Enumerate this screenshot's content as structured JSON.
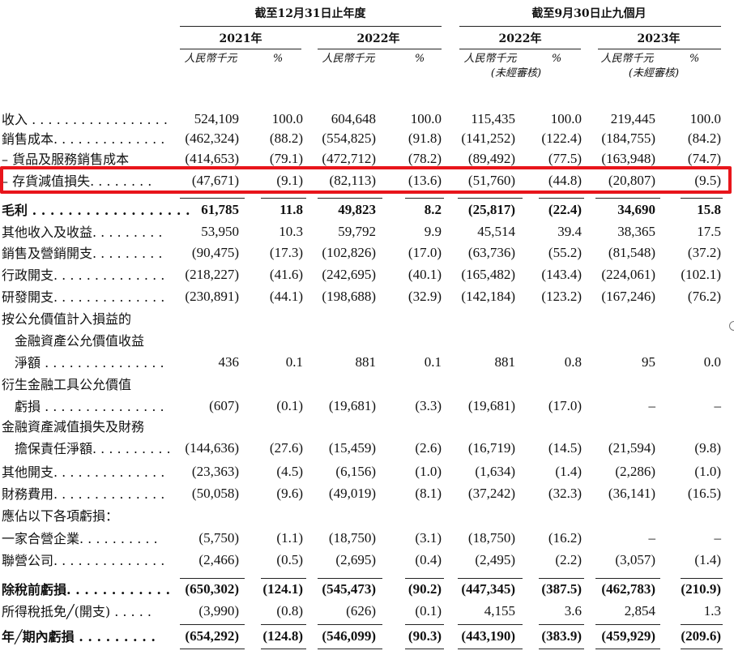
{
  "header": {
    "group_annual": "截至12月31日止年度",
    "group_nine": "截至9月30日止九個月",
    "years": [
      "2021年",
      "2022年",
      "2022年",
      "2023年"
    ],
    "unit_rmb": "人民幣千元",
    "unit_pct": "%",
    "unaudited": "(未經審核)"
  },
  "rows": [
    {
      "lines": [
        "收入 . . . . . . . . . . . . . . . . ."
      ],
      "values": [
        "524,109",
        "100.0",
        "604,648",
        "100.0",
        "115,435",
        "100.0",
        "219,445",
        "100.0"
      ]
    },
    {
      "lines": [
        "銷售成本. . . . . . . . . . . . . ."
      ],
      "values": [
        "(462,324)",
        "(88.2)",
        "(554,825)",
        "(91.8)",
        "(141,252)",
        "(122.4)",
        "(184,755)",
        "(84.2)"
      ]
    },
    {
      "lines": [
        "– 貨品及服務銷售成本"
      ],
      "values": [
        "(414,653)",
        "(79.1)",
        "(472,712)",
        "(78.2)",
        "(89,492)",
        "(77.5)",
        "(163,948)",
        "(74.7)"
      ]
    },
    {
      "lines": [
        "– 存貨減值損失. . . . . . . ."
      ],
      "values": [
        "(47,671)",
        "(9.1)",
        "(82,113)",
        "(13.6)",
        "(51,760)",
        "(44.8)",
        "(20,807)",
        "(9.5)"
      ]
    },
    {
      "lines": [
        "毛利 . . . . . . . . . . . . . . . . . ."
      ],
      "values": [
        "61,785",
        "11.8",
        "49,823",
        "8.2",
        "(25,817)",
        "(22.4)",
        "34,690",
        "15.8"
      ]
    },
    {
      "lines": [
        "其他收入及收益. . . . . . . . ."
      ],
      "values": [
        "53,950",
        "10.3",
        "59,792",
        "9.9",
        "45,514",
        "39.4",
        "38,365",
        "17.5"
      ]
    },
    {
      "lines": [
        "銷售及營銷開支. . . . . . . . ."
      ],
      "values": [
        "(90,475)",
        "(17.3)",
        "(102,826)",
        "(17.0)",
        "(63,736)",
        "(55.2)",
        "(81,548)",
        "(37.2)"
      ]
    },
    {
      "lines": [
        "行政開支. . . . . . . . . . . . . ."
      ],
      "values": [
        "(218,227)",
        "(41.6)",
        "(242,695)",
        "(40.1)",
        "(165,482)",
        "(143.4)",
        "(224,061)",
        "(102.1)"
      ]
    },
    {
      "lines": [
        "研發開支. . . . . . . . . . . . . ."
      ],
      "values": [
        "(230,891)",
        "(44.1)",
        "(198,688)",
        "(32.9)",
        "(142,184)",
        "(123.2)",
        "(167,246)",
        "(76.2)"
      ]
    },
    {
      "lines": [
        "按公允價值計入損益的",
        "金融資產公允價值收益",
        "淨額 . . . . . . . . . . . . . . ."
      ],
      "values": [
        "436",
        "0.1",
        "881",
        "0.1",
        "881",
        "0.8",
        "95",
        "0.0"
      ]
    },
    {
      "lines": [
        "衍生金融工具公允價值",
        "虧損 . . . . . . . . . . . . . . ."
      ],
      "values": [
        "(607)",
        "(0.1)",
        "(19,681)",
        "(3.3)",
        "(19,681)",
        "(17.0)",
        "–",
        "–"
      ]
    },
    {
      "lines": [
        "金融資產減值損失及財務",
        "擔保責任淨額. . . . . . . . . ."
      ],
      "values": [
        "(144,636)",
        "(27.6)",
        "(15,459)",
        "(2.6)",
        "(16,719)",
        "(14.5)",
        "(21,594)",
        "(9.8)"
      ]
    },
    {
      "lines": [
        "其他開支. . . . . . . . . . . . . ."
      ],
      "values": [
        "(23,363)",
        "(4.5)",
        "(6,156)",
        "(1.0)",
        "(1,634)",
        "(1.4)",
        "(2,286)",
        "(1.0)"
      ]
    },
    {
      "lines": [
        "財務費用. . . . . . . . . . . . . ."
      ],
      "values": [
        "(50,058)",
        "(9.6)",
        "(49,019)",
        "(8.1)",
        "(37,242)",
        "(32.3)",
        "(36,141)",
        "(16.5)"
      ]
    },
    {
      "lines": [
        "應佔以下各項虧損："
      ],
      "values": [
        "",
        "",
        "",
        "",
        "",
        "",
        "",
        ""
      ]
    },
    {
      "lines": [
        "一家合營企業. . . . . . . . . ."
      ],
      "values": [
        "(5,750)",
        "(1.1)",
        "(18,750)",
        "(3.1)",
        "(18,750)",
        "(16.2)",
        "–",
        "–"
      ]
    },
    {
      "lines": [
        "聯營公司. . . . . . . . . . . . . ."
      ],
      "values": [
        "(2,466)",
        "(0.5)",
        "(2,695)",
        "(0.4)",
        "(2,495)",
        "(2.2)",
        "(3,057)",
        "(1.4)"
      ]
    },
    {
      "lines": [
        "除稅前虧損. . . . . . . . . . . ."
      ],
      "values": [
        "(650,302)",
        "(124.1)",
        "(545,473)",
        "(90.2)",
        "(447,345)",
        "(387.5)",
        "(462,783)",
        "(210.9)"
      ]
    },
    {
      "lines": [
        "所得稅抵免╱(開支) . . . . ."
      ],
      "values": [
        "(3,990)",
        "(0.8)",
        "(626)",
        "(0.1)",
        "4,155",
        "3.6",
        "2,854",
        "1.3"
      ]
    },
    {
      "lines": [
        "年╱期內虧損 . . . . . . . . ."
      ],
      "values": [
        "(654,292)",
        "(124.8)",
        "(546,099)",
        "(90.3)",
        "(443,190)",
        "(383.9)",
        "(459,929)",
        "(209.6)"
      ]
    }
  ]
}
